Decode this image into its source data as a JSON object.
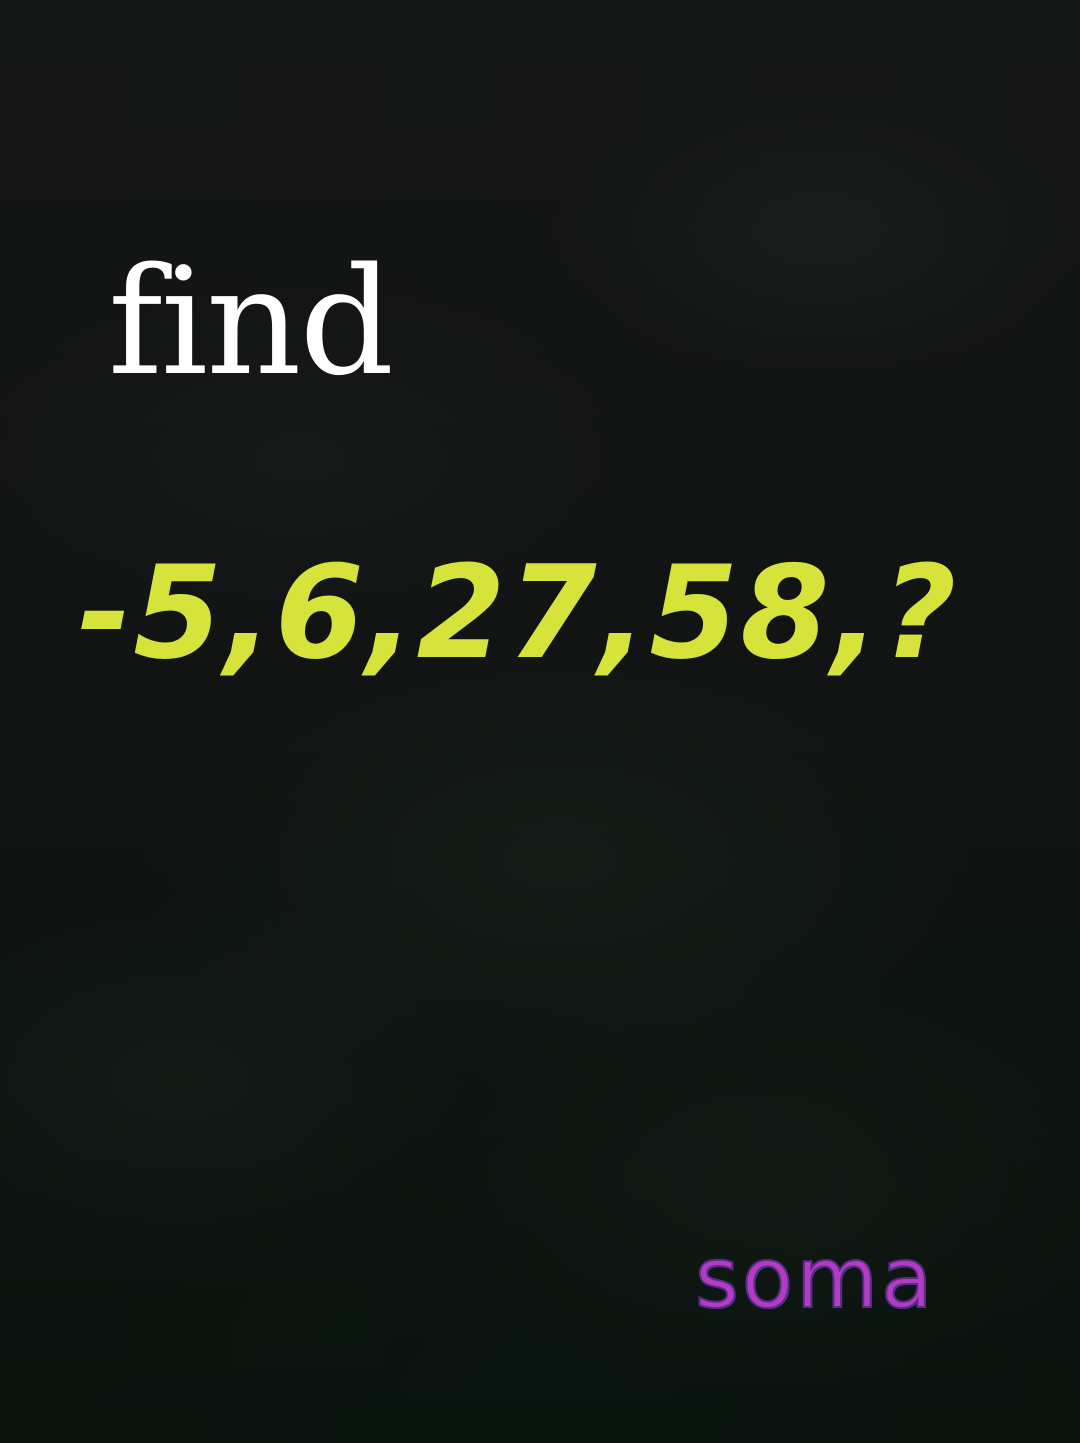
{
  "heading": {
    "text": "find"
  },
  "puzzle": {
    "sequence_text": "-5,6,27,58,?",
    "terms": [
      "-5",
      "6",
      "27",
      "58",
      "?"
    ]
  },
  "watermark": {
    "text": "soma"
  },
  "colors": {
    "background": "#111312",
    "heading": "#ffffff",
    "sequence": "#d6e33a",
    "watermark": "#b23cc4"
  }
}
